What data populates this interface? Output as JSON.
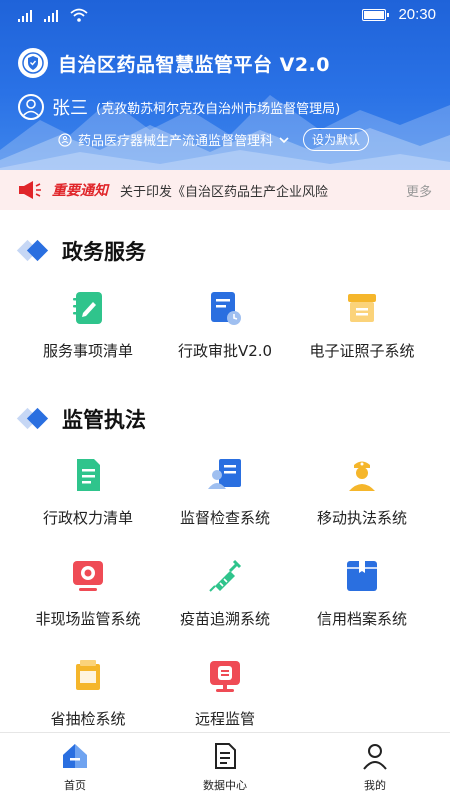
{
  "status_bar": {
    "time": "20:30",
    "battery_level": 0.9
  },
  "header": {
    "platform_title": "自治区药品智慧监管平台 V2.0",
    "user_name": "张三",
    "user_org": "(克孜勒苏柯尔克孜自治州市场监督管理局)",
    "department": "药品医疗器械生产流通监督管理科",
    "set_default_label": "设为默认"
  },
  "notice": {
    "tag": "重要通知",
    "text": "关于印发《自治区药品生产企业风险",
    "more_label": "更多"
  },
  "sections": [
    {
      "title": "政务服务",
      "items": [
        {
          "label": "服务事项清单",
          "icon": "service-list-icon"
        },
        {
          "label": "行政审批V2.0",
          "icon": "approval-doc-icon"
        },
        {
          "label": "电子证照子系统",
          "icon": "license-box-icon"
        }
      ]
    },
    {
      "title": "监管执法",
      "items": [
        {
          "label": "行政权力清单",
          "icon": "power-list-icon"
        },
        {
          "label": "监督检查系统",
          "icon": "inspection-icon"
        },
        {
          "label": "移动执法系统",
          "icon": "officer-icon"
        },
        {
          "label": "非现场监管系统",
          "icon": "monitor-icon"
        },
        {
          "label": "疫苗追溯系统",
          "icon": "syringe-icon"
        },
        {
          "label": "信用档案系统",
          "icon": "archive-icon"
        },
        {
          "label": "省抽检系统",
          "icon": "sampling-icon"
        },
        {
          "label": "远程监管",
          "icon": "remote-monitor-icon"
        }
      ]
    }
  ],
  "bottom_nav": [
    {
      "label": "首页",
      "icon": "home-icon",
      "active": true
    },
    {
      "label": "数据中心",
      "icon": "document-icon",
      "active": false
    },
    {
      "label": "我的",
      "icon": "user-icon",
      "active": false
    }
  ],
  "colors": {
    "primary": "#2a6fe0",
    "notice_red": "#e0252a",
    "green": "#2fc48c",
    "orange": "#f5b62b",
    "red": "#ef4b55"
  }
}
